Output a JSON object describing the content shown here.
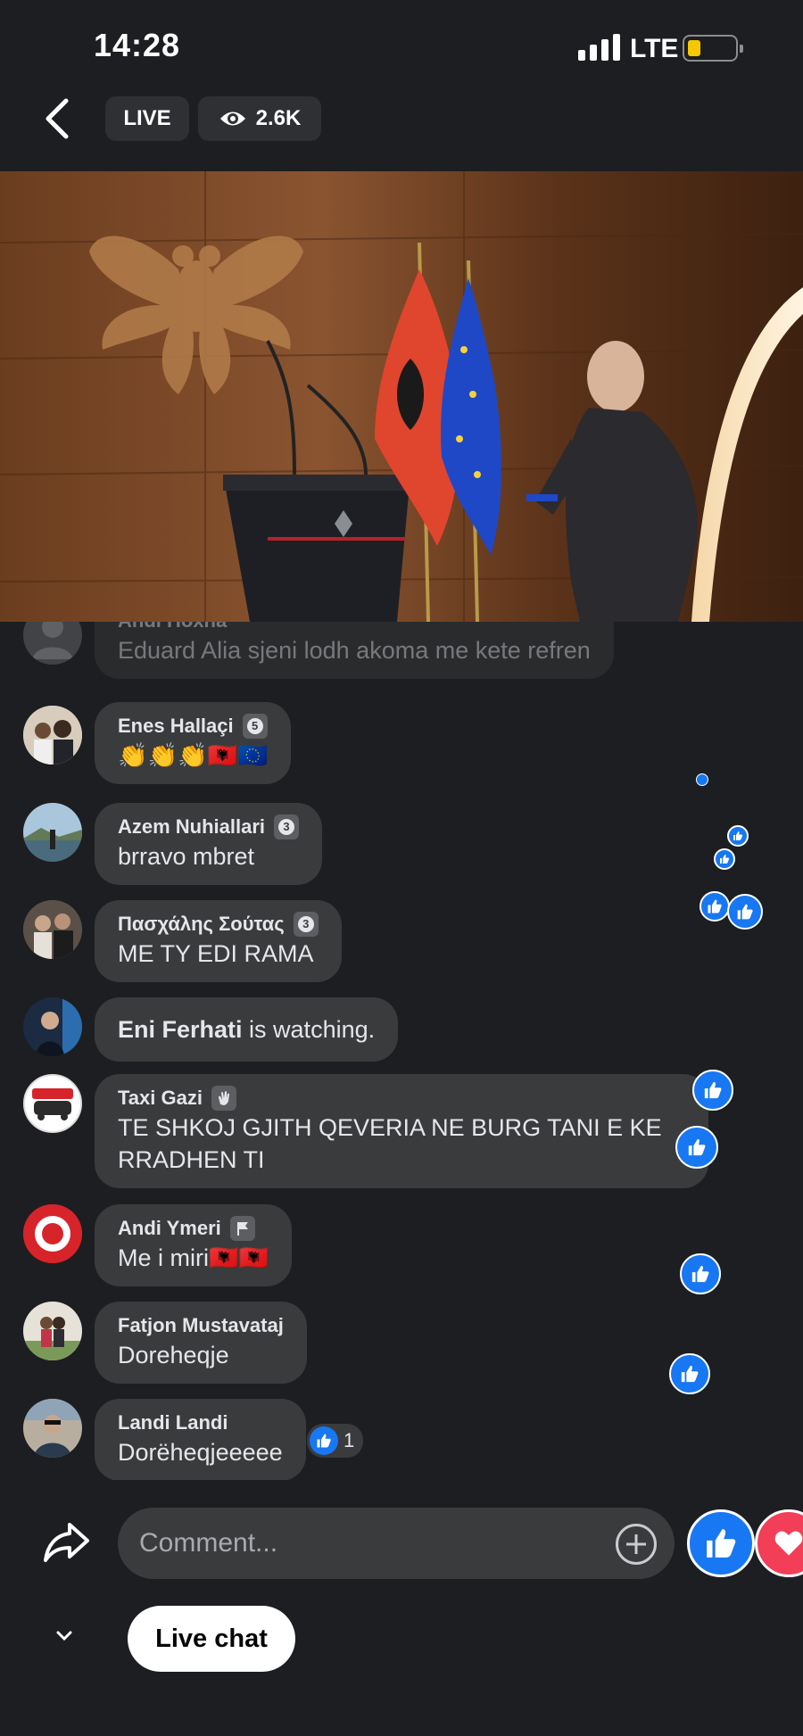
{
  "status_bar": {
    "time": "14:28",
    "network": "LTE",
    "battery_level": 0.2
  },
  "header": {
    "live_label": "LIVE",
    "viewers": "2.6K"
  },
  "comments": [
    {
      "name": "Andi Hoxha",
      "text": "Eduard Alia sjeni lodh akoma me kete refren",
      "faded": true
    },
    {
      "name": "Enes Hallaçi",
      "badge": "5",
      "text": "👏👏👏🇦🇱🇪🇺"
    },
    {
      "name": "Azem Nuhiallari",
      "badge": "3",
      "text": "brravo mbret"
    },
    {
      "name": "Πασχάλης Σούτας",
      "badge": "3",
      "text": "ME TY EDI RAMA"
    },
    {
      "name": "Eni Ferhati",
      "text": "is watching."
    },
    {
      "name": "Taxi Gazi",
      "badge_icon": "wave-icon",
      "text": "TE SHKOJ GJITH QEVERIA NE BURG TANI E KE RRADHEN TI"
    },
    {
      "name": "Andi Ymeri",
      "badge_icon": "flag-icon",
      "text": "Me i miri🇦🇱🇦🇱"
    },
    {
      "name": "Fatjon Mustavataj",
      "text": "Doreheqje"
    },
    {
      "name": "Landi Landi",
      "text": "Dorëheqjeeeee",
      "reactions": "1"
    }
  ],
  "composer": {
    "placeholder": "Comment..."
  },
  "bottom": {
    "live_chat_label": "Live chat"
  },
  "colors": {
    "background": "#1c1e21",
    "bubble": "#3a3b3c",
    "like_blue": "#1877f2",
    "love_red": "#f33e58"
  }
}
